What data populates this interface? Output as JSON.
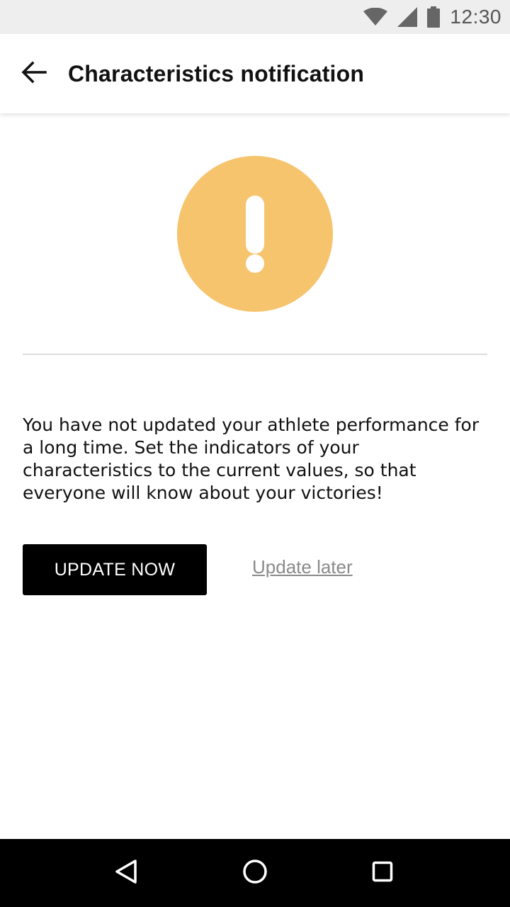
{
  "status_bar": {
    "time": "12:30",
    "icons": [
      "wifi-icon",
      "signal-icon",
      "battery-icon"
    ]
  },
  "app_bar": {
    "back_icon": "arrow-back-icon",
    "title": "Characteristics notification"
  },
  "warning": {
    "icon": "exclamation-icon",
    "color": "#f7c46e"
  },
  "message": "You have not updated your athlete performance for a long time. Set the indicators of your characteristics to the current values, so that everyone will know about your victories!",
  "actions": {
    "primary_label": "UPDATE NOW",
    "secondary_label": "Update later"
  },
  "nav_bar": {
    "icons": [
      "nav-back-icon",
      "nav-home-icon",
      "nav-recents-icon"
    ]
  }
}
